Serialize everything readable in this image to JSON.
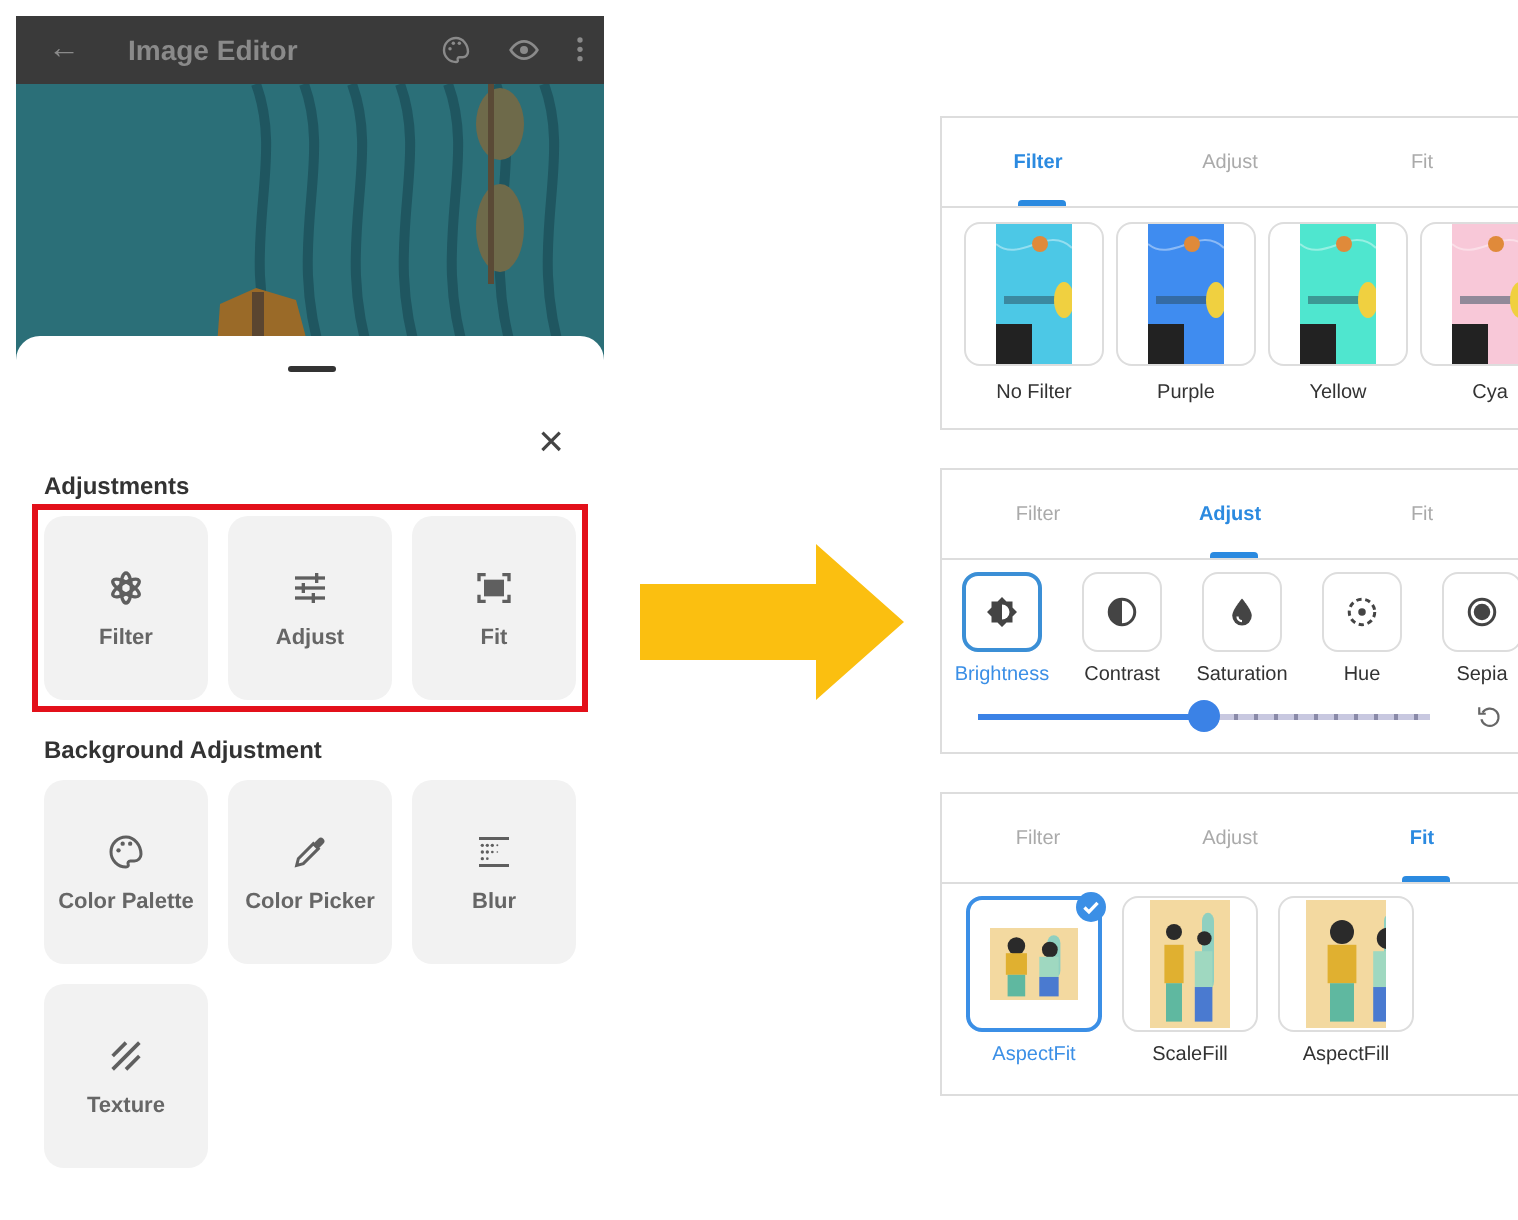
{
  "phone": {
    "app_bar": {
      "back": "←",
      "title": "Image Editor",
      "actions": [
        {
          "kind": "palette"
        },
        {
          "kind": "eye"
        },
        {
          "kind": "more"
        }
      ]
    },
    "sheet": {
      "close": "×",
      "sections": [
        {
          "title": "Adjustments",
          "highlighted": true,
          "tools": [
            {
              "label": "Filter",
              "kind": "filter"
            },
            {
              "label": "Adjust",
              "kind": "sliders"
            },
            {
              "label": "Fit",
              "kind": "fit"
            }
          ]
        },
        {
          "title": "Background Adjustment",
          "highlighted": false,
          "tools": [
            {
              "label": "Color Palette",
              "kind": "palette"
            },
            {
              "label": "Color Picker",
              "kind": "picker"
            },
            {
              "label": "Blur",
              "kind": "blur"
            },
            {
              "label": "Texture",
              "kind": "texture"
            }
          ]
        }
      ]
    }
  },
  "panels": [
    {
      "kind": "filters",
      "tabs": [
        {
          "label": "Filter",
          "selected": true
        },
        {
          "label": "Adjust",
          "selected": false
        },
        {
          "label": "Fit",
          "selected": false
        }
      ],
      "items": [
        {
          "label": "No Filter",
          "color": "#4cc8e6"
        },
        {
          "label": "Purple",
          "color": "#3f8cf0"
        },
        {
          "label": "Yellow",
          "color": "#4fe6cf"
        },
        {
          "label": "Cya",
          "color": "#f8c8d8"
        }
      ]
    },
    {
      "kind": "adjust",
      "tabs": [
        {
          "label": "Filter",
          "selected": false
        },
        {
          "label": "Adjust",
          "selected": true
        },
        {
          "label": "Fit",
          "selected": false
        }
      ],
      "items": [
        {
          "label": "Brightness",
          "kind": "brightness",
          "selected": true
        },
        {
          "label": "Contrast",
          "kind": "contrast",
          "selected": false
        },
        {
          "label": "Saturation",
          "kind": "drop",
          "selected": false
        },
        {
          "label": "Hue",
          "kind": "hue",
          "selected": false
        },
        {
          "label": "Sepia",
          "kind": "sepia",
          "selected": false
        }
      ],
      "slider": {
        "level": 0.5
      }
    },
    {
      "kind": "fit",
      "tabs": [
        {
          "label": "Filter",
          "selected": false
        },
        {
          "label": "Adjust",
          "selected": false
        },
        {
          "label": "Fit",
          "selected": true
        }
      ],
      "items": [
        {
          "label": "AspectFit",
          "kind": "fit",
          "selected": true
        },
        {
          "label": "ScaleFill",
          "kind": "scale",
          "selected": false
        },
        {
          "label": "AspectFill",
          "kind": "fill",
          "selected": false
        }
      ]
    }
  ]
}
